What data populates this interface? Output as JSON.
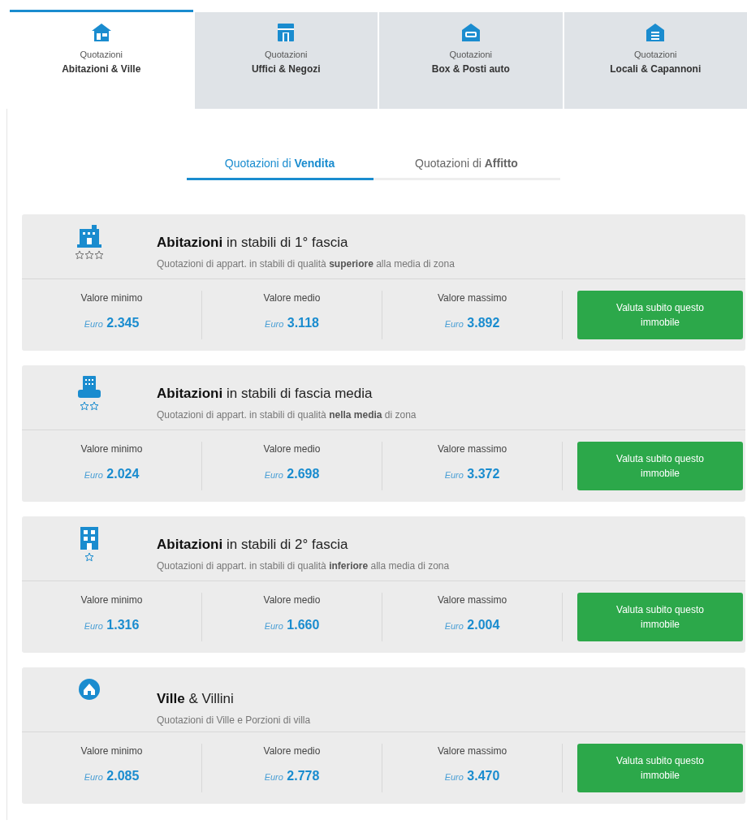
{
  "category_tabs": [
    {
      "caption": "Quotazioni",
      "label": "Abitazioni & Ville",
      "selected": true
    },
    {
      "caption": "Quotazioni",
      "label": "Uffici & Negozi",
      "selected": false
    },
    {
      "caption": "Quotazioni",
      "label": "Box & Posti auto",
      "selected": false
    },
    {
      "caption": "Quotazioni",
      "label": "Locali & Capannoni",
      "selected": false
    }
  ],
  "mode_tabs": [
    {
      "label": "Quotazioni di **Vendita**",
      "selected": true
    },
    {
      "label": "Quotazioni di **Affitto**",
      "selected": false
    }
  ],
  "cards": [
    {
      "kind": "first-tier",
      "title": "**Abitazioni** in stabili di 1° fascia",
      "subtitle": "Quotazioni di appart. in stabili di qualità **superiore** alla media di zona",
      "values": [
        {
          "label": "Valore minimo",
          "currency": "Euro",
          "amount": "2.345"
        },
        {
          "label": "Valore medio",
          "currency": "Euro",
          "amount": "3.118"
        },
        {
          "label": "Valore massimo",
          "currency": "Euro",
          "amount": "3.892"
        }
      ],
      "button": "Valuta subito questo immobile"
    },
    {
      "kind": "mid-tier",
      "title": "**Abitazioni** in stabili di fascia media",
      "subtitle": "Quotazioni di appart. in stabili di qualità **nella media** di zona",
      "values": [
        {
          "label": "Valore minimo",
          "currency": "Euro",
          "amount": "2.024"
        },
        {
          "label": "Valore medio",
          "currency": "Euro",
          "amount": "2.698"
        },
        {
          "label": "Valore massimo",
          "currency": "Euro",
          "amount": "3.372"
        }
      ],
      "button": "Valuta subito questo immobile"
    },
    {
      "kind": "second-tier",
      "title": "**Abitazioni** in stabili di 2° fascia",
      "subtitle": "Quotazioni di appart. in stabili di qualità **inferiore** alla media di zona",
      "values": [
        {
          "label": "Valore minimo",
          "currency": "Euro",
          "amount": "1.316"
        },
        {
          "label": "Valore medio",
          "currency": "Euro",
          "amount": "1.660"
        },
        {
          "label": "Valore massimo",
          "currency": "Euro",
          "amount": "2.004"
        }
      ],
      "button": "Valuta subito questo immobile"
    },
    {
      "kind": "villa",
      "title": "**Ville** & Villini",
      "subtitle": "Quotazioni di Ville e Porzioni di villa",
      "values": [
        {
          "label": "Valore minimo",
          "currency": "Euro",
          "amount": "2.085"
        },
        {
          "label": "Valore medio",
          "currency": "Euro",
          "amount": "2.778"
        },
        {
          "label": "Valore massimo",
          "currency": "Euro",
          "amount": "3.470"
        }
      ],
      "button": "Valuta subito questo immobile"
    }
  ]
}
